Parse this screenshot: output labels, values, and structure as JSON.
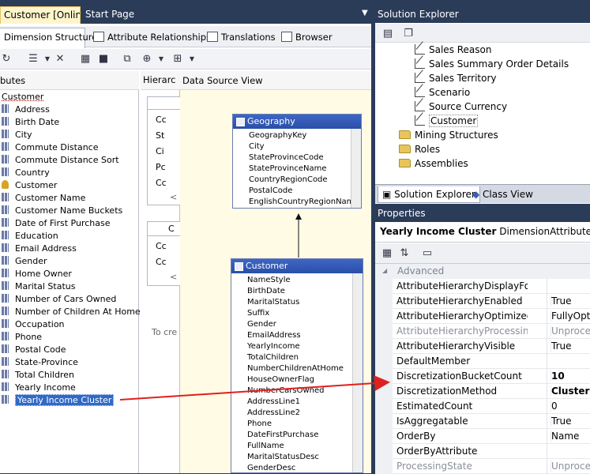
{
  "doc_tabs": [
    {
      "label": "Customer [Online]",
      "close": "✕"
    },
    {
      "label": "Start Page"
    }
  ],
  "designer_tabs": [
    "Dimension Structure",
    "Attribute Relationships",
    "Translations",
    "Browser"
  ],
  "panes": {
    "attributes_header": "butes",
    "hierarchies_header": "Hierarc",
    "dsv_header": "Data Source View",
    "hier_hint": "To cre"
  },
  "attributes": {
    "root": "Customer",
    "items": [
      "Address",
      "Birth Date",
      "City",
      "Commute Distance",
      "Commute Distance Sort",
      "Country",
      "Customer",
      "Customer Name",
      "Customer Name Buckets",
      "Date of First Purchase",
      "Education",
      "Email Address",
      "Gender",
      "Home Owner",
      "Marital Status",
      "Number of Cars Owned",
      "Number of Children At Home",
      "Occupation",
      "Phone",
      "Postal Code",
      "State-Province",
      "Total Children",
      "Yearly Income",
      "Yearly Income Cluster"
    ],
    "selected": "Yearly Income Cluster",
    "key_item": "Customer"
  },
  "hierarchies": {
    "box1": [
      "Cc",
      "St",
      "Ci",
      "Pc",
      "Cc"
    ],
    "box1_more": "<",
    "box2_title": "C",
    "box2": [
      "Cc",
      "Cc"
    ],
    "box2_more": "<"
  },
  "dsv": {
    "geography": {
      "title": "Geography",
      "columns": [
        "GeographyKey",
        "City",
        "StateProvinceCode",
        "StateProvinceName",
        "CountryRegionCode",
        "PostalCode",
        "EnglishCountryRegionName"
      ]
    },
    "customer": {
      "title": "Customer",
      "columns": [
        "NameStyle",
        "BirthDate",
        "MaritalStatus",
        "Suffix",
        "Gender",
        "EmailAddress",
        "YearlyIncome",
        "TotalChildren",
        "NumberChildrenAtHome",
        "HouseOwnerFlag",
        "NumberCarsOwned",
        "AddressLine1",
        "AddressLine2",
        "Phone",
        "DateFirstPurchase",
        "FullName",
        "MaritalStatusDesc",
        "GenderDesc"
      ]
    }
  },
  "solution_explorer": {
    "title": "Solution Explorer",
    "items": [
      {
        "label": "Sales Reason",
        "kind": "dim"
      },
      {
        "label": "Sales Summary Order Details",
        "kind": "dim"
      },
      {
        "label": "Sales Territory",
        "kind": "dim"
      },
      {
        "label": "Scenario",
        "kind": "dim"
      },
      {
        "label": "Source Currency",
        "kind": "dim"
      },
      {
        "label": "Customer",
        "kind": "dim"
      },
      {
        "label": "Mining Structures",
        "kind": "folder"
      },
      {
        "label": "Roles",
        "kind": "folder"
      },
      {
        "label": "Assemblies",
        "kind": "folder"
      }
    ],
    "tabs": [
      "Solution Explorer",
      "Class View"
    ]
  },
  "properties": {
    "title": "Properties",
    "object_name": "Yearly Income Cluster",
    "object_type": "DimensionAttribute",
    "category": "Advanced",
    "rows": [
      {
        "name": "AttributeHierarchyDisplayFolder",
        "value": ""
      },
      {
        "name": "AttributeHierarchyEnabled",
        "value": "True"
      },
      {
        "name": "AttributeHierarchyOptimizedState",
        "value": "FullyOptim"
      },
      {
        "name": "AttributeHierarchyProcessingState",
        "value": "Unproces",
        "grey": true
      },
      {
        "name": "AttributeHierarchyVisible",
        "value": "True"
      },
      {
        "name": "DefaultMember",
        "value": ""
      },
      {
        "name": "DiscretizationBucketCount",
        "value": "10",
        "bold": true
      },
      {
        "name": "DiscretizationMethod",
        "value": "Clusters",
        "bold": true
      },
      {
        "name": "EstimatedCount",
        "value": "0"
      },
      {
        "name": "IsAggregatable",
        "value": "True"
      },
      {
        "name": "OrderBy",
        "value": "Name"
      },
      {
        "name": "OrderByAttribute",
        "value": ""
      },
      {
        "name": "ProcessingState",
        "value": "Unproces",
        "grey": true
      }
    ]
  },
  "colors": {
    "frame": "#2b3c59",
    "selection": "#3169c6",
    "table_header": "#2a4fa8",
    "dsv_bg": "#fffbe5",
    "arrow": "#e0201e"
  }
}
